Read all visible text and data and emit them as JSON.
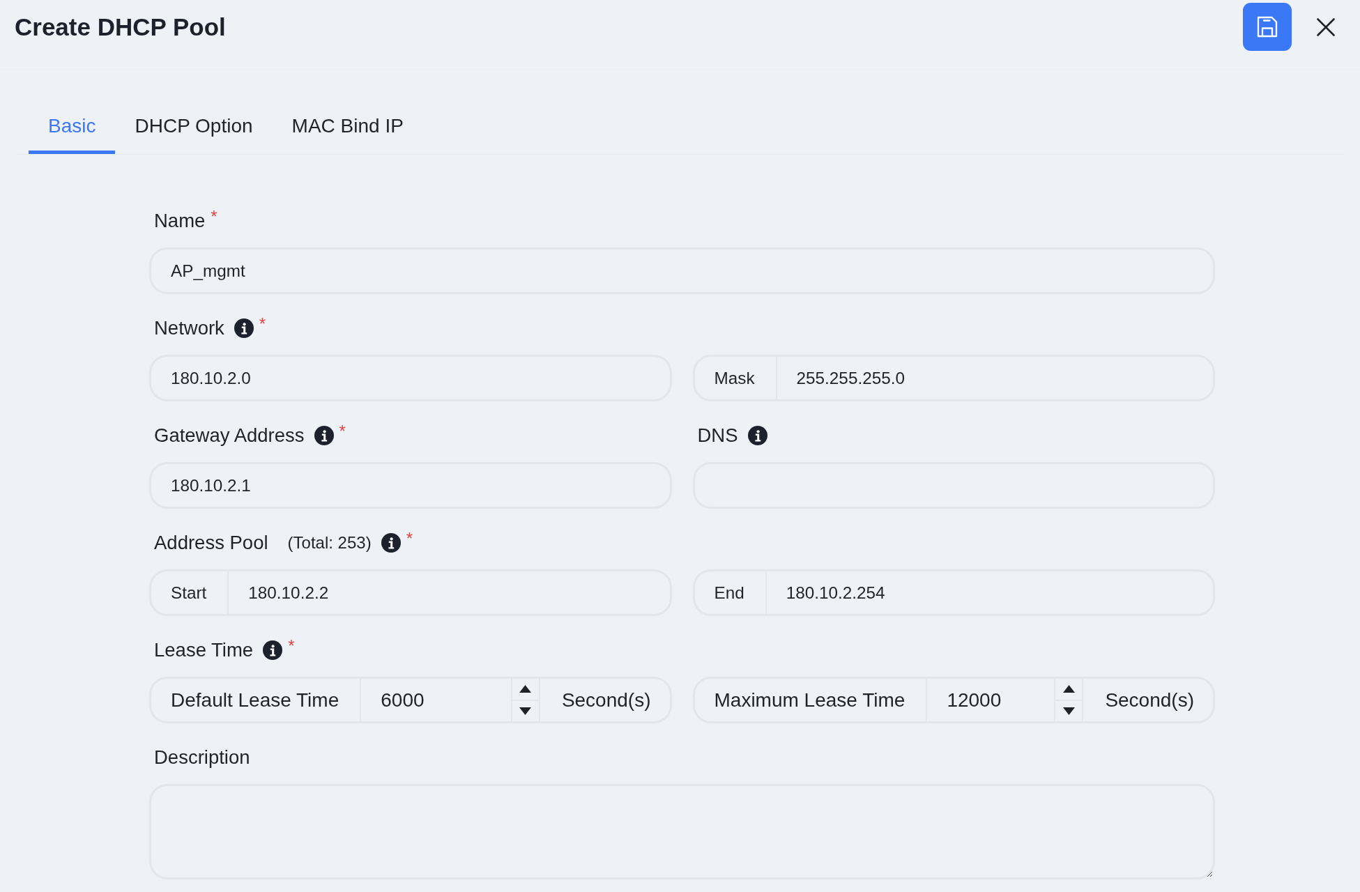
{
  "title": "Create DHCP Pool",
  "tabs": [
    {
      "label": "Basic",
      "selected": true
    },
    {
      "label": "DHCP Option",
      "selected": false
    },
    {
      "label": "MAC Bind IP",
      "selected": false
    }
  ],
  "form_rows": [
    {
      "groups": [
        {
          "label": "Name",
          "info": false,
          "required_mark": "*",
          "controls": [
            {
              "kind": "text",
              "value": "AP_mgmt"
            }
          ]
        }
      ]
    },
    {
      "groups": [
        {
          "label": "Network",
          "info": true,
          "required_mark": "*",
          "controls": [
            {
              "kind": "text",
              "value": "180.10.2.0"
            },
            {
              "kind": "addon",
              "addon": "Mask",
              "value": "255.255.255.0"
            }
          ]
        }
      ]
    },
    {
      "groups": [
        {
          "label": "Gateway Address",
          "info": true,
          "required_mark": "*",
          "controls": [
            {
              "kind": "text",
              "value": "180.10.2.1"
            }
          ]
        },
        {
          "label": "DNS",
          "info": true,
          "controls": [
            {
              "kind": "text"
            }
          ]
        }
      ]
    },
    {
      "groups": [
        {
          "label": "Address Pool",
          "note": "(Total: 253)",
          "info": true,
          "required_mark": "*",
          "controls": [
            {
              "kind": "addon",
              "addon": "Start",
              "value": "180.10.2.2"
            },
            {
              "kind": "addon",
              "addon": "End",
              "value": "180.10.2.254"
            }
          ]
        }
      ]
    },
    {
      "groups": [
        {
          "label": "Lease Time",
          "info": true,
          "required_mark": "*",
          "controls": [
            {
              "kind": "spin",
              "addon": "Default Lease Time",
              "value": "6000",
              "unit": "Second(s)"
            },
            {
              "kind": "spin",
              "addon": "Maximum Lease Time",
              "value": "12000",
              "unit": "Second(s)"
            }
          ]
        }
      ]
    },
    {
      "groups": [
        {
          "label": "Description",
          "info": false,
          "controls": [
            {
              "kind": "textarea"
            }
          ]
        }
      ]
    }
  ]
}
